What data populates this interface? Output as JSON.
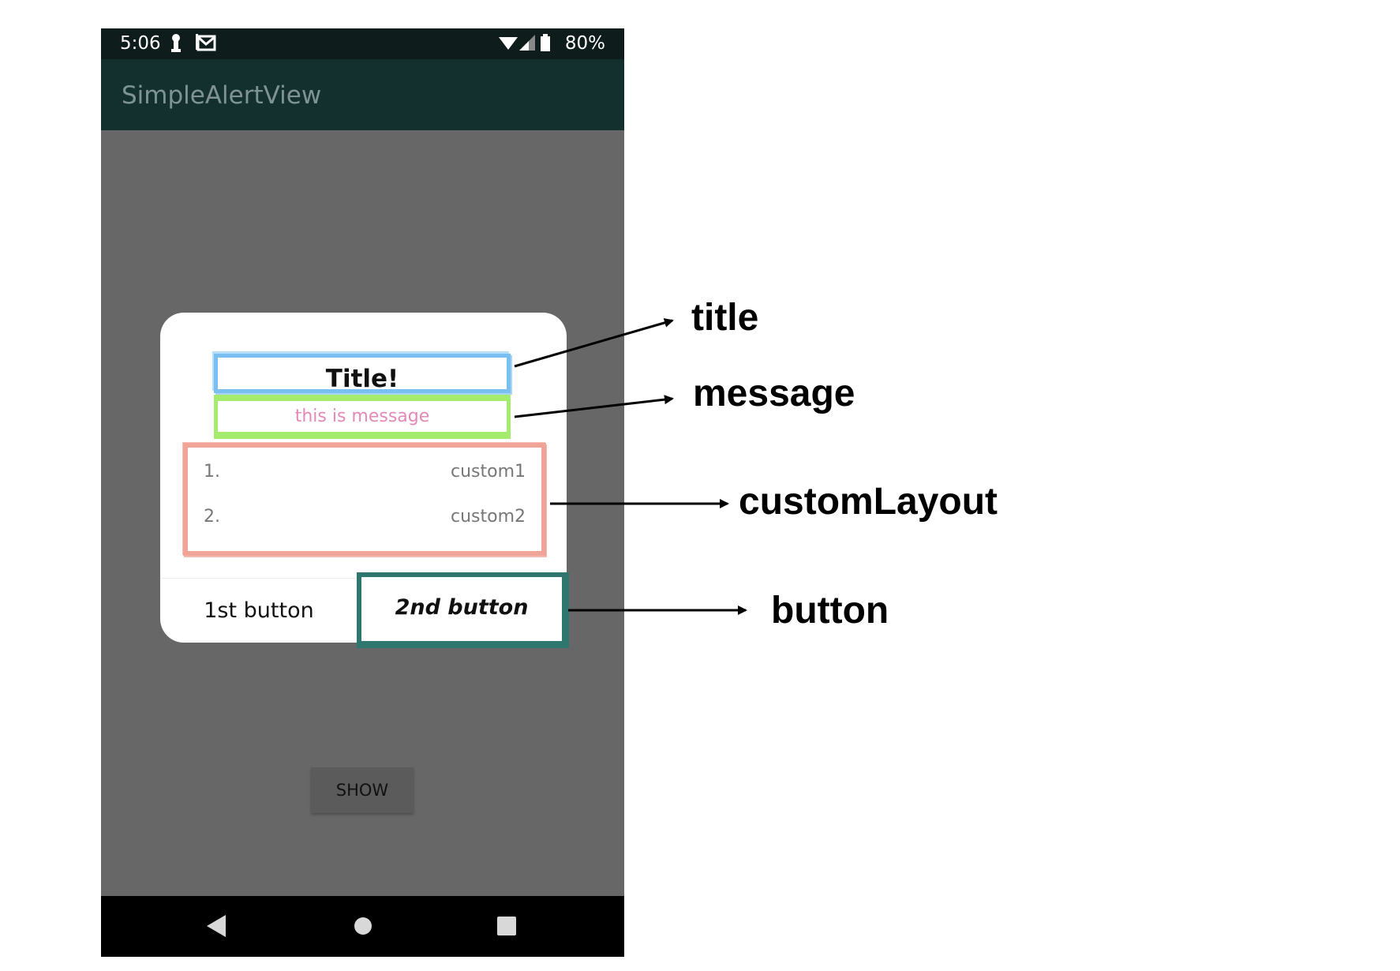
{
  "status_bar": {
    "time": "5:06",
    "battery": "80%"
  },
  "app_bar": {
    "title": "SimpleAlertView"
  },
  "dialog": {
    "title": "Title!",
    "message": "this is message",
    "rows": [
      {
        "number": "1.",
        "label": "custom1"
      },
      {
        "number": "2.",
        "label": "custom2"
      }
    ],
    "button1": "1st button",
    "button2": "2nd button"
  },
  "show_button": "SHOW",
  "annotations": {
    "title": "title",
    "message": "message",
    "custom_layout": "customLayout",
    "button": "button"
  },
  "colors": {
    "title_frame": "#79bff2",
    "message_frame": "#a4ec6d",
    "custom_frame": "#f0a397",
    "button_frame": "#2f766e",
    "message_text": "#e489b7",
    "app_bar": "#13302e"
  },
  "icons": [
    "key-icon",
    "gmail-icon",
    "wifi-icon",
    "signal-icon",
    "battery-icon",
    "back-icon",
    "home-icon",
    "recents-icon"
  ]
}
